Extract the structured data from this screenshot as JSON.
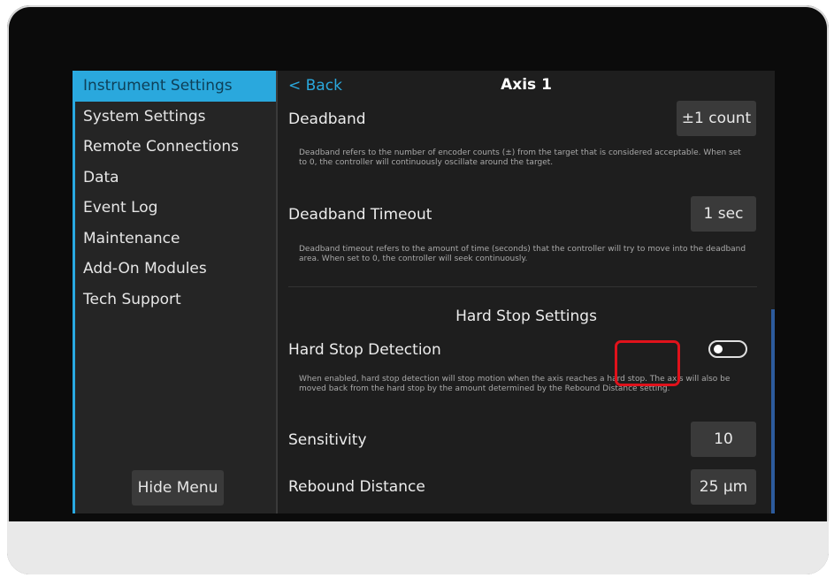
{
  "sidebar": {
    "items": [
      {
        "label": "Instrument Settings",
        "active": true
      },
      {
        "label": "System Settings"
      },
      {
        "label": "Remote Connections"
      },
      {
        "label": "Data"
      },
      {
        "label": "Event Log"
      },
      {
        "label": "Maintenance"
      },
      {
        "label": "Add-On Modules"
      },
      {
        "label": "Tech Support"
      }
    ],
    "hide_menu_label": "Hide Menu"
  },
  "header": {
    "back_label": "< Back",
    "title": "Axis 1"
  },
  "settings": {
    "deadband": {
      "label": "Deadband",
      "value": "±1 count",
      "description": "Deadband refers to the number of encoder counts (±) from the target that is considered acceptable. When set to 0, the controller will continuously oscillate around the target."
    },
    "deadband_timeout": {
      "label": "Deadband Timeout",
      "value": "1 sec",
      "description": "Deadband timeout refers to the amount of time (seconds) that the controller will try to move into the deadband area. When set to 0, the controller will seek continuously."
    },
    "hard_stop_section": "Hard Stop Settings",
    "hard_stop_detection": {
      "label": "Hard Stop Detection",
      "enabled": false,
      "description": "When enabled, hard stop detection will stop motion when the axis reaches a hard stop. The axis will also be moved back from the hard stop by the amount determined by the Rebound Distance setting."
    },
    "sensitivity": {
      "label": "Sensitivity",
      "value": "10"
    },
    "rebound_distance": {
      "label": "Rebound Distance",
      "value": "25 µm"
    }
  },
  "colors": {
    "accent": "#2aa8dd",
    "highlight": "#e0121b",
    "background": "#1e1e1e"
  }
}
